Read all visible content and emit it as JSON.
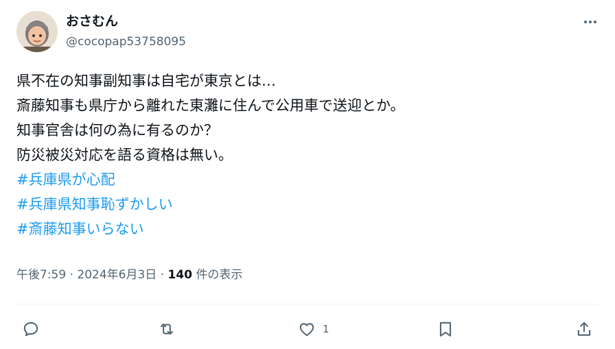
{
  "author": {
    "display_name": "おさむん",
    "handle": "@cocopap53758095"
  },
  "tweet": {
    "lines": [
      "県不在の知事副知事は自宅が東京とは…",
      "斎藤知事も県庁から離れた東灘に住んで公用車で送迎とか。",
      "知事官舎は何の為に有るのか？",
      "防災被災対応を語る資格は無い。"
    ],
    "hashtags": [
      "#兵庫県が心配",
      "#兵庫県知事恥ずかしい",
      "#斎藤知事いらない"
    ]
  },
  "meta": {
    "time": "午後7:59",
    "separator": "·",
    "date": "2024年6月3日",
    "views_count": "140",
    "views_label": "件の表示"
  },
  "actions": {
    "reply_count": "",
    "retweet_count": "",
    "like_count": "1"
  },
  "icons": [
    "more-icon",
    "reply-icon",
    "retweet-icon",
    "like-icon",
    "bookmark-icon",
    "share-icon"
  ],
  "colors": {
    "hashtag": "#1d9bf0",
    "secondary_text": "#536471",
    "divider": "#eff3f4"
  }
}
